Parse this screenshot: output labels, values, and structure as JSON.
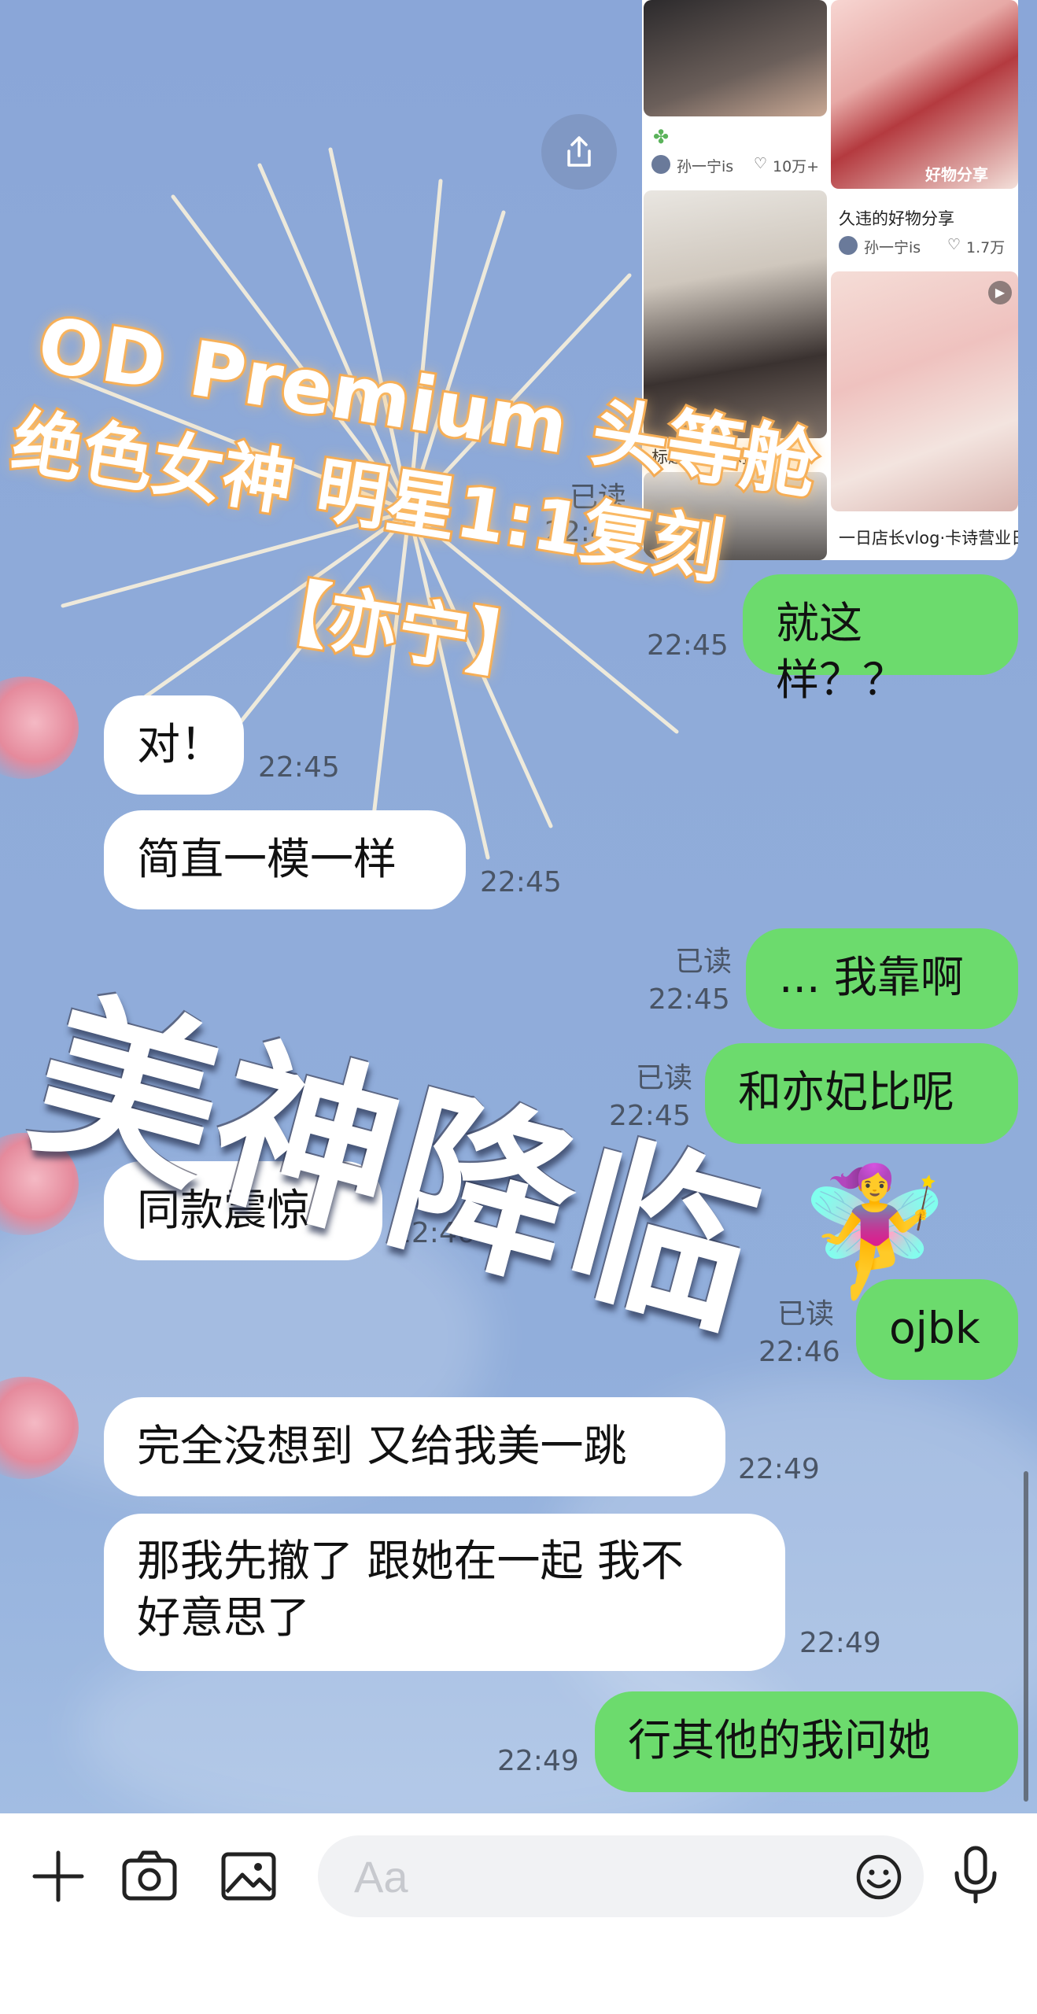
{
  "shared_card": {
    "item1": {
      "author": "孙一宁is",
      "likes": "10万+"
    },
    "item2": {
      "title": "久违的好物分享",
      "author": "孙一宁is",
      "likes": "1.7万"
    },
    "item3": {
      "title": "标题没没想好"
    },
    "item4": {
      "title": "一日店长vlog·卡诗营业日记"
    },
    "sticker": "好物分享"
  },
  "overlay": {
    "line1": "OD Premium 头等舱",
    "line2": "绝色女神 明星1:1复刻",
    "line3": "【亦宁】",
    "big_title": "美神降临"
  },
  "messages": [
    {
      "side": "out",
      "read": "已读",
      "time": "22:45",
      "text": ""
    },
    {
      "side": "out",
      "read": "",
      "time": "22:45",
      "text": "就这样？？"
    },
    {
      "side": "in",
      "time": "22:45",
      "text": "对！"
    },
    {
      "side": "in",
      "time": "22:45",
      "text": "简直一模一样"
    },
    {
      "side": "out",
      "read": "已读",
      "time": "22:45",
      "text": "... 我靠啊"
    },
    {
      "side": "out",
      "read": "已读",
      "time": "22:45",
      "text": "和亦妃比呢"
    },
    {
      "side": "in",
      "time": "22:46",
      "text": "同款震惊."
    },
    {
      "side": "out",
      "read": "已读",
      "time": "22:46",
      "text": "ojbk"
    },
    {
      "side": "in",
      "time": "22:49",
      "text": "完全没想到 又给我美一跳"
    },
    {
      "side": "in",
      "time": "22:49",
      "text": "那我先撤了 跟她在一起 我不\n好意思了"
    },
    {
      "side": "out",
      "read": "",
      "time": "22:49",
      "text": "行其他的我问她"
    }
  ],
  "sticker_emoji": "🧚‍♀️",
  "toolbar": {
    "input_placeholder": "Aa",
    "icons": [
      "plus-icon",
      "camera-icon",
      "image-icon",
      "emoji-icon",
      "microphone-icon"
    ]
  },
  "colors": {
    "outgoing": "#6cdb6d",
    "incoming": "#ffffff",
    "background": "#8ea9d6",
    "promo_outline": "#f3a64c"
  }
}
